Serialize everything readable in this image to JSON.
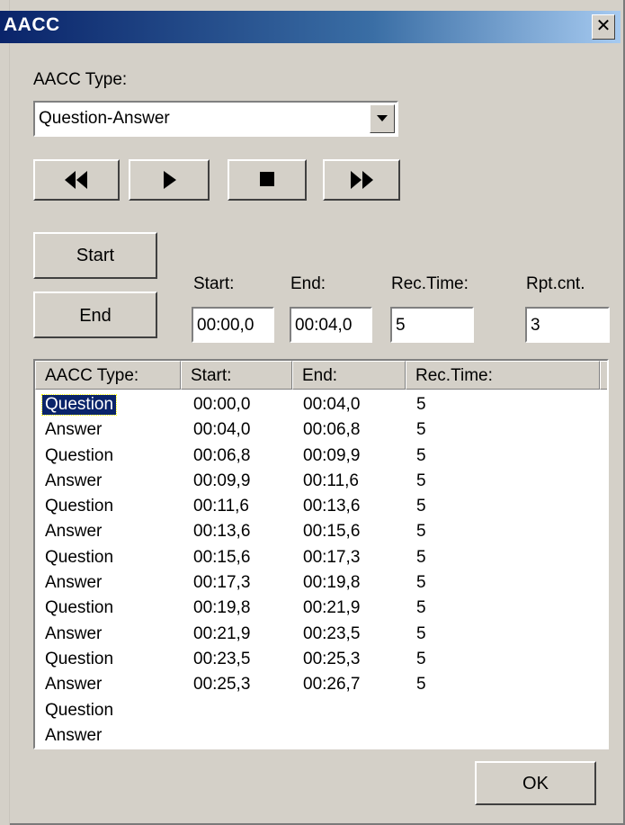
{
  "window": {
    "title": "AACC",
    "close_glyph": "✕"
  },
  "type_label": "AACC Type:",
  "type_select": {
    "value": "Question-Answer",
    "icon": "chevron-down-icon"
  },
  "media": {
    "rewind": "rewind-icon",
    "play": "play-icon",
    "stop": "stop-icon",
    "forward": "fast-forward-icon"
  },
  "buttons": {
    "start": "Start",
    "end": "End",
    "ok": "OK"
  },
  "fields": {
    "start_label": "Start:",
    "start_value": "00:00,0",
    "end_label": "End:",
    "end_value": "00:04,0",
    "rec_label": "Rec.Time:",
    "rec_value": "5",
    "rpt_label": "Rpt.cnt.",
    "rpt_value": "3"
  },
  "table": {
    "headers": [
      "AACC Type:",
      "Start:",
      "End:",
      "Rec.Time:"
    ],
    "selected_row": 0,
    "rows": [
      [
        "Question",
        "00:00,0",
        "00:04,0",
        "5"
      ],
      [
        "Answer",
        "00:04,0",
        "00:06,8",
        "5"
      ],
      [
        "Question",
        "00:06,8",
        "00:09,9",
        "5"
      ],
      [
        "Answer",
        "00:09,9",
        "00:11,6",
        "5"
      ],
      [
        "Question",
        "00:11,6",
        "00:13,6",
        "5"
      ],
      [
        "Answer",
        "00:13,6",
        "00:15,6",
        "5"
      ],
      [
        "Question",
        "00:15,6",
        "00:17,3",
        "5"
      ],
      [
        "Answer",
        "00:17,3",
        "00:19,8",
        "5"
      ],
      [
        "Question",
        "00:19,8",
        "00:21,9",
        "5"
      ],
      [
        "Answer",
        "00:21,9",
        "00:23,5",
        "5"
      ],
      [
        "Question",
        "00:23,5",
        "00:25,3",
        "5"
      ],
      [
        "Answer",
        "00:25,3",
        "00:26,7",
        "5"
      ],
      [
        "Question",
        "",
        "",
        ""
      ],
      [
        "Answer",
        "",
        "",
        ""
      ]
    ]
  }
}
